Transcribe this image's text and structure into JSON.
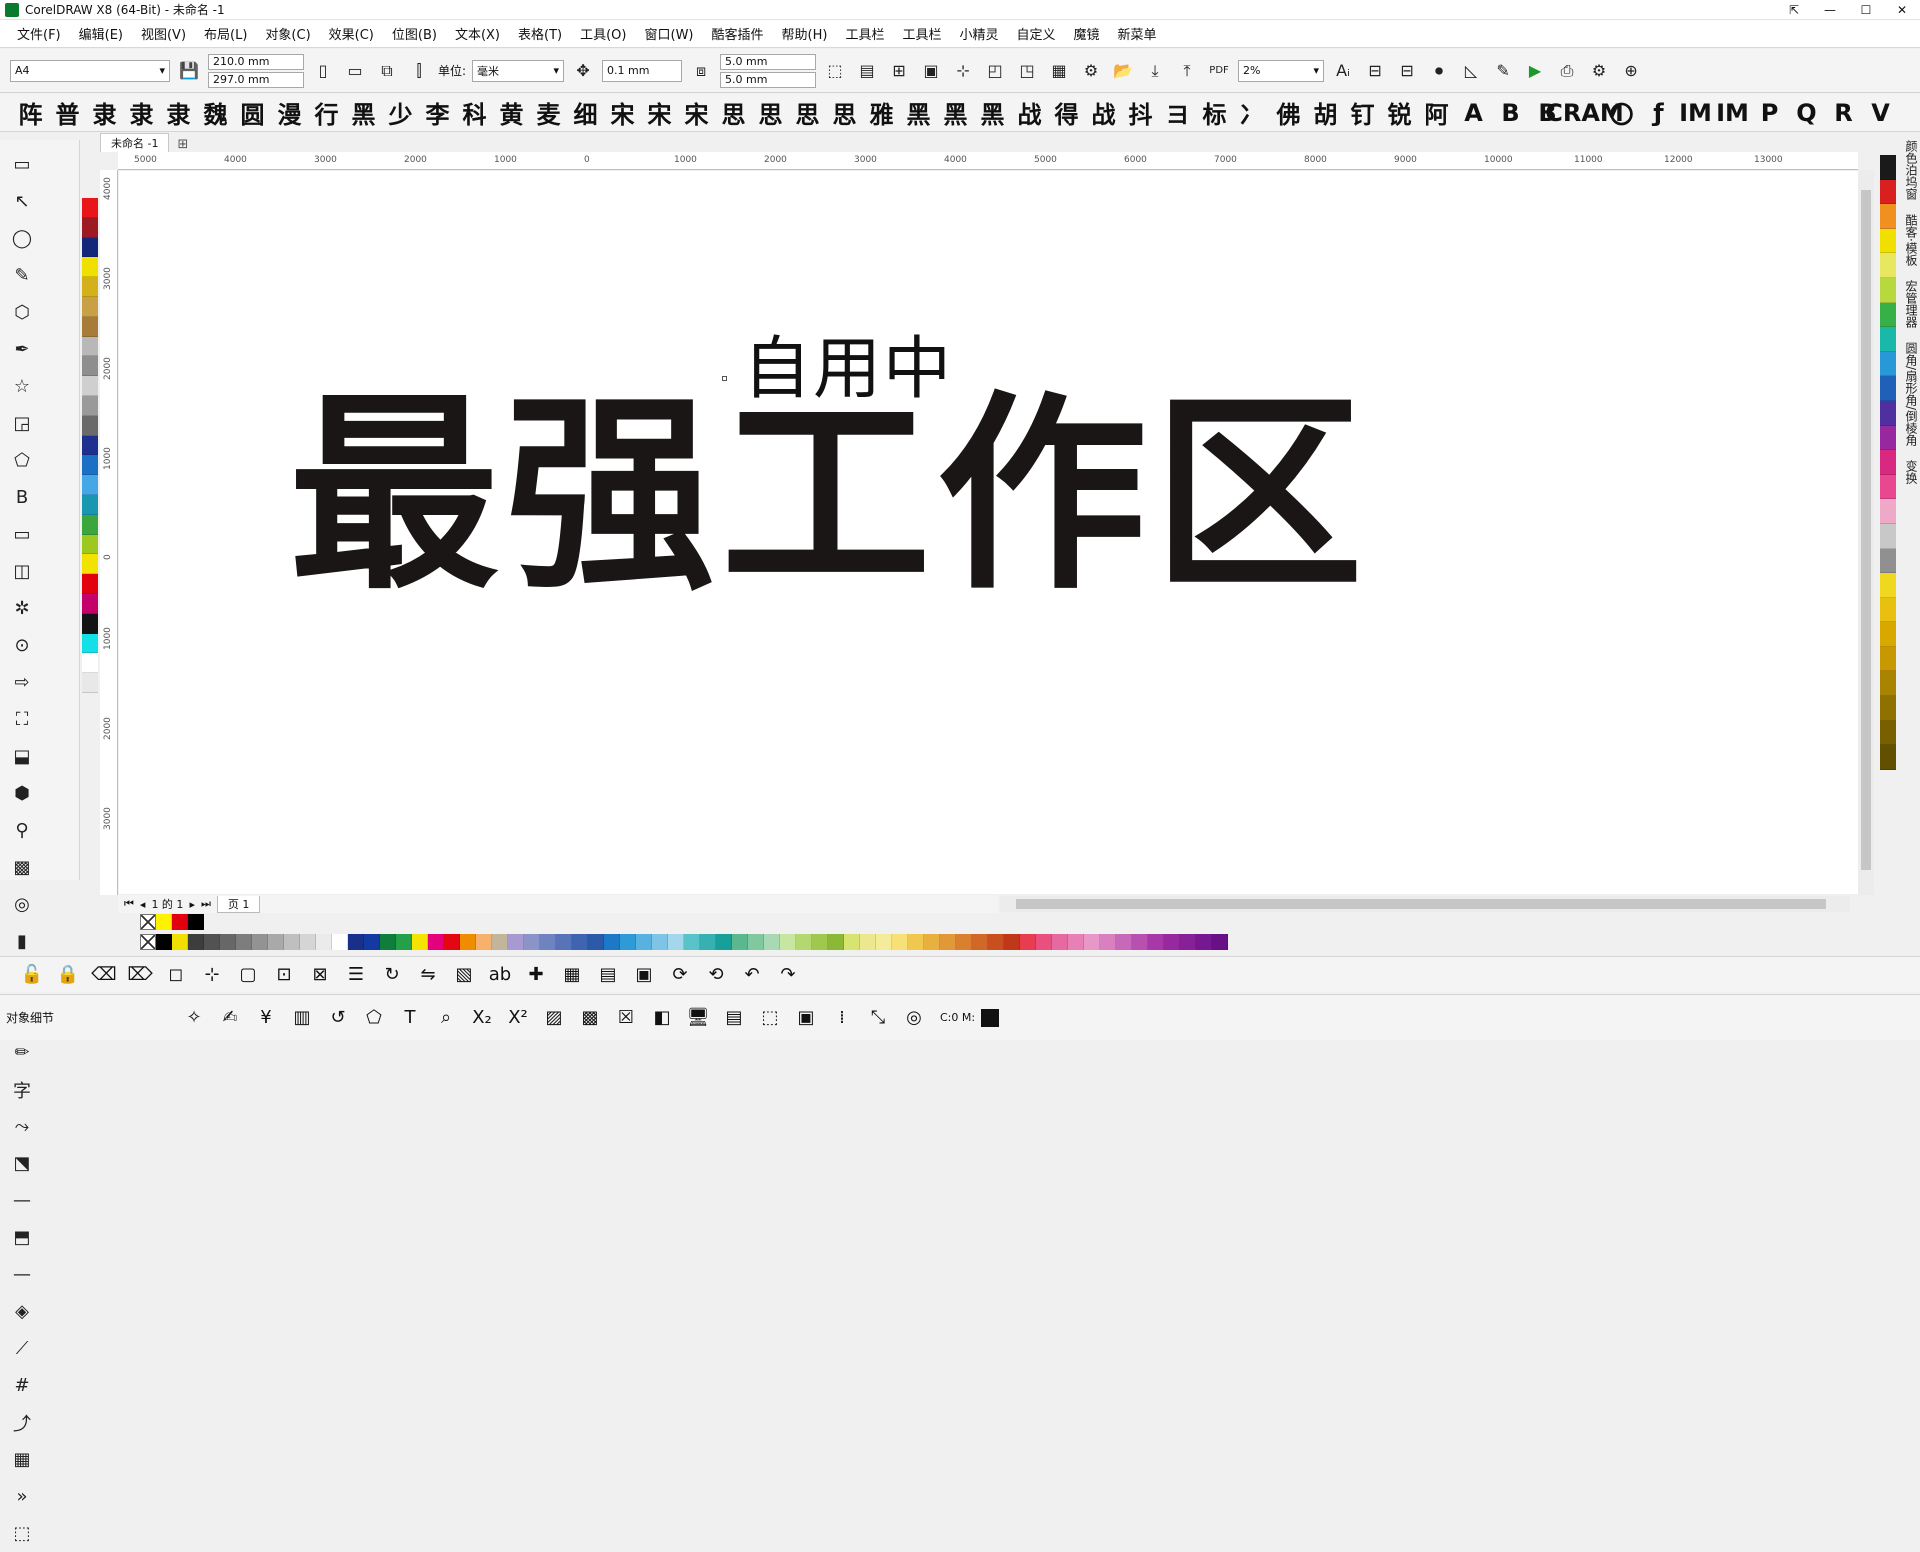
{
  "window": {
    "title": "CorelDRAW X8 (64-Bit) - 未命名 -1",
    "controls": [
      "⇱",
      "—",
      "☐",
      "✕"
    ]
  },
  "menu": [
    "文件(F)",
    "编辑(E)",
    "视图(V)",
    "布局(L)",
    "对象(C)",
    "效果(C)",
    "位图(B)",
    "文本(X)",
    "表格(T)",
    "工具(O)",
    "窗口(W)",
    "酷客插件",
    "帮助(H)",
    "工具栏",
    "工具栏",
    "小精灵",
    "自定义",
    "魔镜",
    "新菜单"
  ],
  "property_bar": {
    "page_size": "A4",
    "width": "210.0 mm",
    "height": "297.0 mm",
    "unit_label": "单位:",
    "unit_value": "毫米",
    "nudge": "0.1 mm",
    "dup_x": "5.0 mm",
    "dup_y": "5.0 mm",
    "zoom": "2%",
    "pdf_label": "PDF"
  },
  "font_bar": [
    "阵",
    "普",
    "隶",
    "隶",
    "隶",
    "魏",
    "圆",
    "漫",
    "行",
    "黑",
    "少",
    "李",
    "科",
    "黄",
    "麦",
    "细",
    "宋",
    "宋",
    "宋",
    "思",
    "思",
    "思",
    "思",
    "雅",
    "黑",
    "黑",
    "黑",
    "战",
    "得",
    "战",
    "抖",
    "ヨ",
    "标",
    "冫",
    "佛",
    "胡",
    "钉",
    "锐",
    "阿",
    "A",
    "B",
    "B",
    "CRAM",
    "〇",
    "ƒ",
    "IM",
    "IM",
    "P",
    "Q",
    "R",
    "V"
  ],
  "toolbox": [
    "▭",
    "↖",
    "◯",
    "✎",
    "⬡",
    "✒",
    "☆",
    "◲",
    "⬠",
    "B",
    "▭",
    "◫",
    "✲",
    "⊙",
    "⇨",
    "⛶",
    "⬓",
    "⬢",
    "⚲",
    "▩",
    "◎",
    "▮",
    "✐",
    "⚕",
    "✏",
    "字",
    "⤳",
    "⬔",
    "—",
    "⬒",
    "—",
    "◈",
    "⟋",
    "#",
    "⤴",
    "▦",
    "»",
    "⬚"
  ],
  "document": {
    "tab_name": "未命名 -1",
    "small_text": "自用中",
    "big_text": "最强工作区",
    "page_count_text": "1 的 1",
    "page_tab": "页 1"
  },
  "ruler_h": [
    "5000",
    "4000",
    "3000",
    "2000",
    "1000",
    "0",
    "1000",
    "2000",
    "3000",
    "4000",
    "5000",
    "6000",
    "7000",
    "8000",
    "9000",
    "10000",
    "11000",
    "12000",
    "13000"
  ],
  "ruler_v": [
    "4000",
    "3000",
    "2000",
    "1000",
    "0",
    "1000",
    "2000",
    "3000"
  ],
  "dockers": [
    "颜色泊坞窗",
    "酷客·模板",
    "宏管理器",
    "圆角/扇形角/倒棱角",
    "变换"
  ],
  "status": {
    "object_details": "对象细节",
    "color_readout": "C:0 M:"
  },
  "colors": {
    "palette_left": [
      "#e8151b",
      "#9d1a22",
      "#12277a",
      "#f0e000",
      "#d4b01a",
      "#c8a046",
      "#a67c38",
      "#b8b8b8",
      "#8e8e8e",
      "#cfcfcf",
      "#9a9a9a",
      "#6a6a6a",
      "#1f2f8f",
      "#1b6fc4",
      "#45a8e6",
      "#1997b0",
      "#3aa63c",
      "#9cc820",
      "#f2e200",
      "#e2000f",
      "#c4006a",
      "#131313",
      "#12dfe8",
      "#ffffff",
      "#e8e8e8"
    ],
    "palette_right": [
      "#1a1a1a",
      "#d82020",
      "#f09020",
      "#f0e000",
      "#e8e860",
      "#b8d840",
      "#38b048",
      "#1ab8a8",
      "#2898d8",
      "#2060b8",
      "#5030a0",
      "#9828a0",
      "#d82880",
      "#e84890",
      "#f0a8c8",
      "#c8c8c8",
      "#909090",
      "#f0d820",
      "#e8c010",
      "#d8a800",
      "#c89800",
      "#a88400",
      "#907000",
      "#786000",
      "#605000"
    ],
    "row1": [
      "#fff200",
      "#e2000f",
      "#000000"
    ],
    "row2": [
      "#000000",
      "#f0e000",
      "#3d3d3d",
      "#525252",
      "#676767",
      "#7d7d7d",
      "#939393",
      "#a9a9a9",
      "#bfbfbf",
      "#d5d5d5",
      "#ebebeb",
      "#ffffff",
      "#1a2f8a",
      "#123aa0",
      "#0f7d3c",
      "#24a148",
      "#f4e400",
      "#e5007e",
      "#e30613",
      "#f08c00",
      "#f6b26b",
      "#c2b59b",
      "#a89ad0",
      "#8b94c8",
      "#6f83c0",
      "#5873b8",
      "#3f64b0",
      "#2a5aa8",
      "#1e78c8",
      "#2e9ad8",
      "#58b2e0",
      "#7ec4e6",
      "#a4d6ec",
      "#58c3c8",
      "#36b0b0",
      "#18a098",
      "#5ab890",
      "#80c8a0",
      "#a8d8b4",
      "#c8e6a0",
      "#b4d870",
      "#a0c850",
      "#8cb838",
      "#d8e470",
      "#ece890",
      "#f4ec98",
      "#f8e078",
      "#f0c850",
      "#e8b040",
      "#e09838",
      "#d88030",
      "#d06828",
      "#c85020",
      "#c03818",
      "#e83c50",
      "#e85080",
      "#e868a0",
      "#e880b8",
      "#e898c8",
      "#d880c0",
      "#c868b8",
      "#b850b0",
      "#a838a8",
      "#9828a0",
      "#882098",
      "#781890",
      "#681088"
    ]
  }
}
